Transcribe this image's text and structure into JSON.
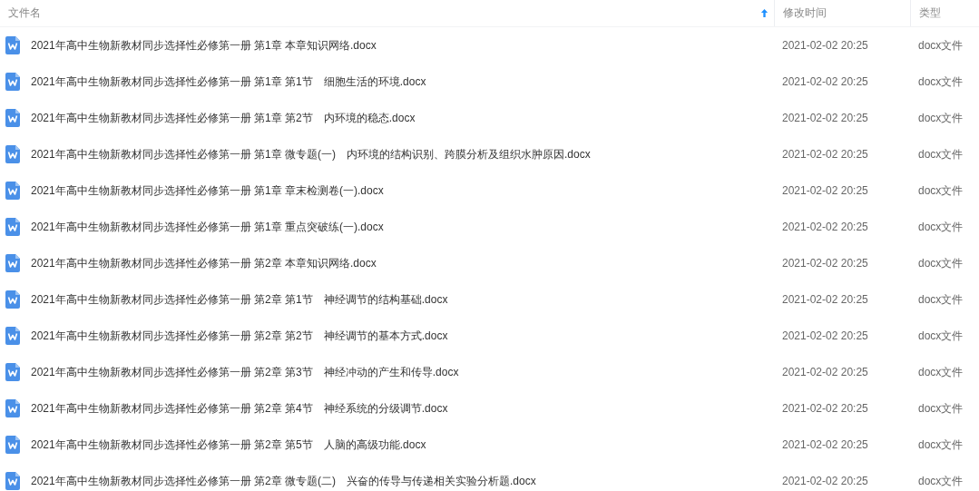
{
  "table": {
    "columns": [
      {
        "label": "文件名",
        "sorted": true
      },
      {
        "label": "修改时间",
        "sorted": false
      },
      {
        "label": "类型",
        "sorted": false
      }
    ],
    "rows": [
      {
        "name": "2021年高中生物新教材同步选择性必修第一册 第1章 本章知识网络.docx",
        "modified": "2021-02-02 20:25",
        "type": "docx文件"
      },
      {
        "name": "2021年高中生物新教材同步选择性必修第一册 第1章 第1节　细胞生活的环境.docx",
        "modified": "2021-02-02 20:25",
        "type": "docx文件"
      },
      {
        "name": "2021年高中生物新教材同步选择性必修第一册 第1章 第2节　内环境的稳态.docx",
        "modified": "2021-02-02 20:25",
        "type": "docx文件"
      },
      {
        "name": "2021年高中生物新教材同步选择性必修第一册 第1章 微专题(一)　内环境的结构识别、跨膜分析及组织水肿原因.docx",
        "modified": "2021-02-02 20:25",
        "type": "docx文件"
      },
      {
        "name": "2021年高中生物新教材同步选择性必修第一册 第1章 章末检测卷(一).docx",
        "modified": "2021-02-02 20:25",
        "type": "docx文件"
      },
      {
        "name": "2021年高中生物新教材同步选择性必修第一册 第1章 重点突破练(一).docx",
        "modified": "2021-02-02 20:25",
        "type": "docx文件"
      },
      {
        "name": "2021年高中生物新教材同步选择性必修第一册 第2章 本章知识网络.docx",
        "modified": "2021-02-02 20:25",
        "type": "docx文件"
      },
      {
        "name": "2021年高中生物新教材同步选择性必修第一册 第2章 第1节　神经调节的结构基础.docx",
        "modified": "2021-02-02 20:25",
        "type": "docx文件"
      },
      {
        "name": "2021年高中生物新教材同步选择性必修第一册 第2章 第2节　神经调节的基本方式.docx",
        "modified": "2021-02-02 20:25",
        "type": "docx文件"
      },
      {
        "name": "2021年高中生物新教材同步选择性必修第一册 第2章 第3节　神经冲动的产生和传导.docx",
        "modified": "2021-02-02 20:25",
        "type": "docx文件"
      },
      {
        "name": "2021年高中生物新教材同步选择性必修第一册 第2章 第4节　神经系统的分级调节.docx",
        "modified": "2021-02-02 20:25",
        "type": "docx文件"
      },
      {
        "name": "2021年高中生物新教材同步选择性必修第一册 第2章 第5节　人脑的高级功能.docx",
        "modified": "2021-02-02 20:25",
        "type": "docx文件"
      },
      {
        "name": "2021年高中生物新教材同步选择性必修第一册 第2章 微专题(二)　兴奋的传导与传递相关实验分析题.docx",
        "modified": "2021-02-02 20:25",
        "type": "docx文件"
      }
    ]
  }
}
